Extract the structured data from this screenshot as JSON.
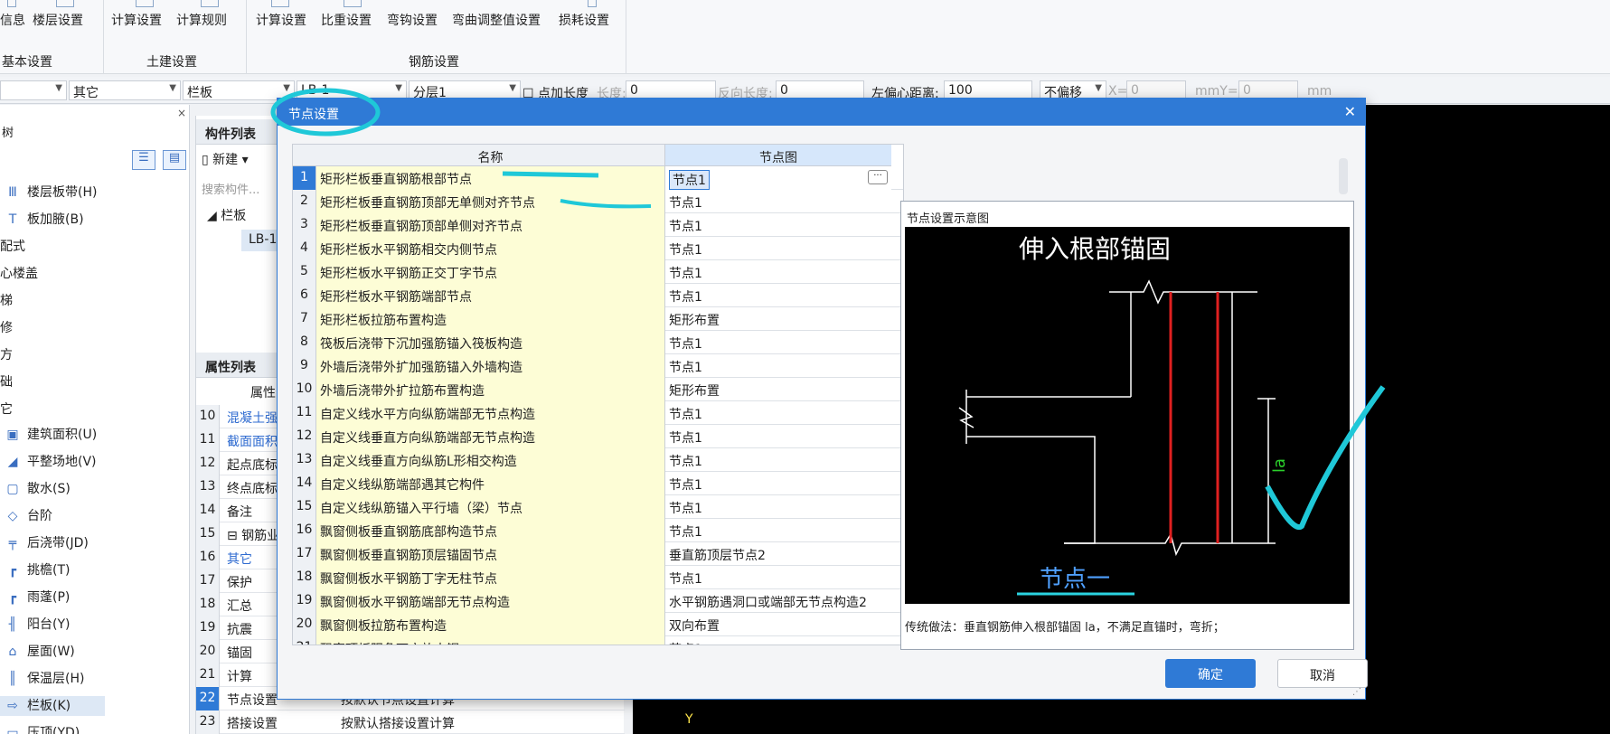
{
  "ribbon": {
    "buttons": [
      "信息",
      "楼层设置",
      "计算设置",
      "计算规则",
      "计算设置",
      "比重设置",
      "弯钩设置",
      "弯曲调整值设置",
      "损耗设置"
    ],
    "groups": [
      "基本设置",
      "土建设置",
      "钢筋设置"
    ]
  },
  "toolbar": {
    "combo1": "",
    "combo2": "其它",
    "combo3": "栏板",
    "combo4": "LB-1",
    "combo5": "分层1",
    "add_length_label": "点加长度",
    "length_label": "长度:",
    "length_value": "0",
    "reverse_length_label": "反向长度:",
    "reverse_length_value": "0",
    "left_offset_label": "左偏心距离:",
    "left_offset_value": "100",
    "offset_mode": "不偏移",
    "x_label": "X=",
    "x_value": "0",
    "mm_y_label": "mmY=",
    "y_value": "0",
    "mm_label": "mm"
  },
  "left_panel": {
    "partial_header": "树",
    "items": [
      {
        "icon": "floor-slab-band-icon",
        "label": "楼层板带(H)",
        "glyph": "Ⅲ"
      },
      {
        "icon": "slab-haunch-icon",
        "label": "板加腋(B)",
        "glyph": "T"
      },
      {
        "icon": "",
        "label": "配式",
        "glyph": ""
      },
      {
        "icon": "",
        "label": "心楼盖",
        "glyph": ""
      },
      {
        "icon": "",
        "label": "梯",
        "glyph": ""
      },
      {
        "icon": "",
        "label": "修",
        "glyph": ""
      },
      {
        "icon": "",
        "label": "方",
        "glyph": ""
      },
      {
        "icon": "",
        "label": "础",
        "glyph": ""
      },
      {
        "icon": "",
        "label": "它",
        "glyph": ""
      },
      {
        "icon": "building-area-icon",
        "label": "建筑面积(U)",
        "glyph": "▣"
      },
      {
        "icon": "site-leveling-icon",
        "label": "平整场地(V)",
        "glyph": "◢"
      },
      {
        "icon": "apron-icon",
        "label": "散水(S)",
        "glyph": "▢"
      },
      {
        "icon": "step-icon",
        "label": "台阶",
        "glyph": "◇"
      },
      {
        "icon": "post-pour-strip-icon",
        "label": "后浇带(JD)",
        "glyph": "╤"
      },
      {
        "icon": "eave-icon",
        "label": "挑檐(T)",
        "glyph": "┏"
      },
      {
        "icon": "canopy-icon",
        "label": "雨蓬(P)",
        "glyph": "┏"
      },
      {
        "icon": "balcony-icon",
        "label": "阳台(Y)",
        "glyph": "╢"
      },
      {
        "icon": "roof-icon",
        "label": "屋面(W)",
        "glyph": "⌂"
      },
      {
        "icon": "insulation-layer-icon",
        "label": "保温层(H)",
        "glyph": "║"
      },
      {
        "icon": "parapet-icon",
        "label": "栏板(K)",
        "glyph": "⇨"
      },
      {
        "icon": "coping-icon",
        "label": "压顶(YD)",
        "glyph": "▭"
      }
    ]
  },
  "component_list": {
    "title": "构件列表",
    "new_label": "新建",
    "search_placeholder": "搜索构件...",
    "tree_root": "栏板",
    "tree_child": "LB-1"
  },
  "property_list": {
    "title": "属性列表",
    "col_header": "属性",
    "rows": [
      {
        "n": "10",
        "k": "混凝土强",
        "v": "",
        "blue": true
      },
      {
        "n": "11",
        "k": "截面面积",
        "v": "",
        "blue": true
      },
      {
        "n": "12",
        "k": "起点底标",
        "v": ""
      },
      {
        "n": "13",
        "k": "终点底标",
        "v": ""
      },
      {
        "n": "14",
        "k": "备注",
        "v": ""
      },
      {
        "n": "15",
        "k": "⊟ 钢筋业",
        "v": ""
      },
      {
        "n": "16",
        "k": "其它",
        "v": "",
        "blue": true
      },
      {
        "n": "17",
        "k": "保护",
        "v": ""
      },
      {
        "n": "18",
        "k": "汇总",
        "v": ""
      },
      {
        "n": "19",
        "k": "抗震",
        "v": ""
      },
      {
        "n": "20",
        "k": "锚固",
        "v": ""
      },
      {
        "n": "21",
        "k": "计算",
        "v": ""
      },
      {
        "n": "22",
        "k": "节点设置",
        "v": "按默认节点设置计算"
      },
      {
        "n": "23",
        "k": "搭接设置",
        "v": "按默认搭接设置计算"
      }
    ]
  },
  "viewport": {
    "axis_label": "Y"
  },
  "dialog": {
    "title": "节点设置",
    "col_name": "名称",
    "col_node": "节点图",
    "rows": [
      {
        "n": "1",
        "name": "矩形栏板垂直钢筋根部节点",
        "node": "节点1"
      },
      {
        "n": "2",
        "name": "矩形栏板垂直钢筋顶部无单侧对齐节点",
        "node": "节点1"
      },
      {
        "n": "3",
        "name": "矩形栏板垂直钢筋顶部单侧对齐节点",
        "node": "节点1"
      },
      {
        "n": "4",
        "name": "矩形栏板水平钢筋相交内侧节点",
        "node": "节点1"
      },
      {
        "n": "5",
        "name": "矩形栏板水平钢筋正交丁字节点",
        "node": "节点1"
      },
      {
        "n": "6",
        "name": "矩形栏板水平钢筋端部节点",
        "node": "节点1"
      },
      {
        "n": "7",
        "name": "矩形栏板拉筋布置构造",
        "node": "矩形布置"
      },
      {
        "n": "8",
        "name": "筏板后浇带下沉加强筋锚入筏板构造",
        "node": "节点1"
      },
      {
        "n": "9",
        "name": "外墙后浇带外扩加强筋锚入外墙构造",
        "node": "节点1"
      },
      {
        "n": "10",
        "name": "外墙后浇带外扩拉筋布置构造",
        "node": "矩形布置"
      },
      {
        "n": "11",
        "name": "自定义线水平方向纵筋端部无节点构造",
        "node": "节点1"
      },
      {
        "n": "12",
        "name": "自定义线垂直方向纵筋端部无节点构造",
        "node": "节点1"
      },
      {
        "n": "13",
        "name": "自定义线垂直方向纵筋L形相交构造",
        "node": "节点1"
      },
      {
        "n": "14",
        "name": "自定义线纵筋端部遇其它构件",
        "node": "节点1"
      },
      {
        "n": "15",
        "name": "自定义线纵筋锚入平行墙（梁）节点",
        "node": "节点1"
      },
      {
        "n": "16",
        "name": "飘窗侧板垂直钢筋底部构造节点",
        "node": "节点1"
      },
      {
        "n": "17",
        "name": "飘窗侧板垂直钢筋顶层锚固节点",
        "node": "垂直筋顶层节点2"
      },
      {
        "n": "18",
        "name": "飘窗侧板水平钢筋丁字无柱节点",
        "node": "节点1"
      },
      {
        "n": "19",
        "name": "飘窗侧板水平钢筋端部无节点构造",
        "node": "水平钢筋遇洞口或端部无节点构造2"
      },
      {
        "n": "20",
        "name": "飘窗侧板拉筋布置构造",
        "node": "双向布置"
      },
      {
        "n": "21",
        "name": "飘窗顶板阳角下方放大钢",
        "node": "节点1"
      }
    ],
    "preview_title": "节点设置示意图",
    "diagram_title": "伸入根部锚固",
    "diagram_label_la": "la",
    "diagram_caption": "节点一",
    "description": "传统做法：垂直钢筋伸入根部锚固 la，不满足直锚时，弯折；",
    "ok_label": "确定",
    "cancel_label": "取消"
  }
}
